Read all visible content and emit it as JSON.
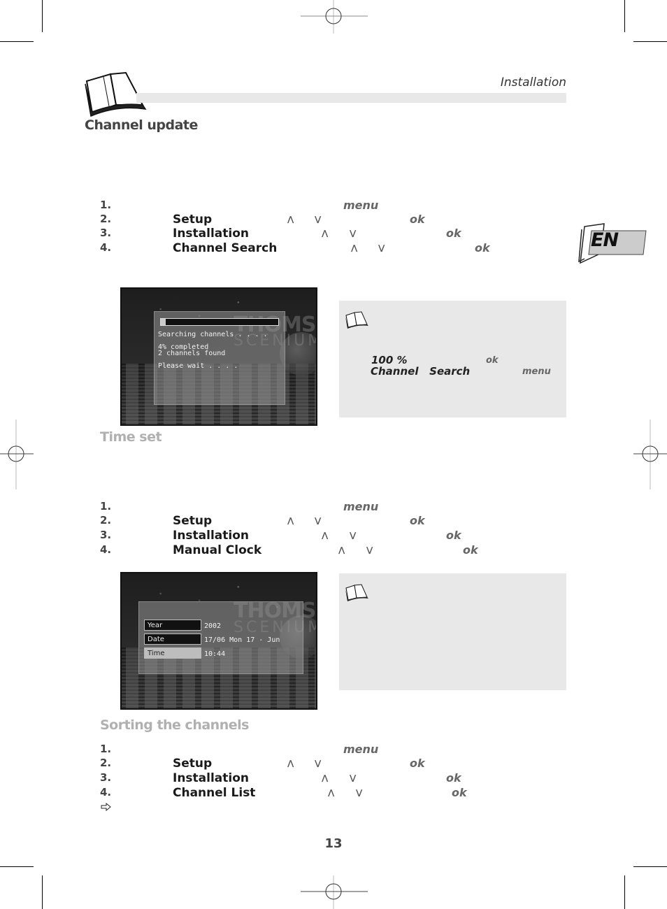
{
  "header": {
    "section_label": "Installation",
    "book_icon": "open-book-icon"
  },
  "language_tab": {
    "label": "EN"
  },
  "channel_update": {
    "title": "Channel update",
    "steps": [
      {
        "num": "1.",
        "item": "",
        "key": "menu"
      },
      {
        "num": "2.",
        "item": "Setup",
        "key": "ok"
      },
      {
        "num": "3.",
        "item": "Installation",
        "key": "ok"
      },
      {
        "num": "4.",
        "item": "Channel Search",
        "key": "ok"
      }
    ],
    "screen": {
      "brand": "THOMSON",
      "brand_sub": "SCENIUM",
      "progress_percent": 4,
      "line1": "Searching channels . . . .",
      "line2": "4% completed",
      "line3": "2 channels found",
      "line4": "Please wait . . . ."
    },
    "note": {
      "text1": "100 %",
      "key1": "ok",
      "text2": "Channel   Search",
      "key2": "menu"
    }
  },
  "time_set": {
    "title": "Time set",
    "steps": [
      {
        "num": "1.",
        "item": "",
        "key": "menu"
      },
      {
        "num": "2.",
        "item": "Setup",
        "key": "ok"
      },
      {
        "num": "3.",
        "item": "Installation",
        "key": "ok"
      },
      {
        "num": "4.",
        "item": "Manual Clock",
        "key": "ok"
      }
    ],
    "screen": {
      "brand": "THOMSON",
      "brand_sub": "SCENIUM",
      "fields": [
        {
          "label": "Year",
          "value": "2002",
          "selected": false
        },
        {
          "label": "Date",
          "value": "17/06 Mon 17 - Jun",
          "selected": false
        },
        {
          "label": "Time",
          "value": "10:44",
          "selected": true
        }
      ]
    }
  },
  "sorting": {
    "title": "Sorting the channels",
    "steps": [
      {
        "num": "1.",
        "item": "",
        "key": "menu"
      },
      {
        "num": "2.",
        "item": "Setup",
        "key": "ok"
      },
      {
        "num": "3.",
        "item": "Installation",
        "key": "ok"
      },
      {
        "num": "4.",
        "item": "Channel List",
        "key": "ok"
      }
    ],
    "arrow_icon": "arrow-right-outline-icon"
  },
  "arrows": {
    "up": "⋀",
    "down": "⋁"
  },
  "page_number": "13"
}
